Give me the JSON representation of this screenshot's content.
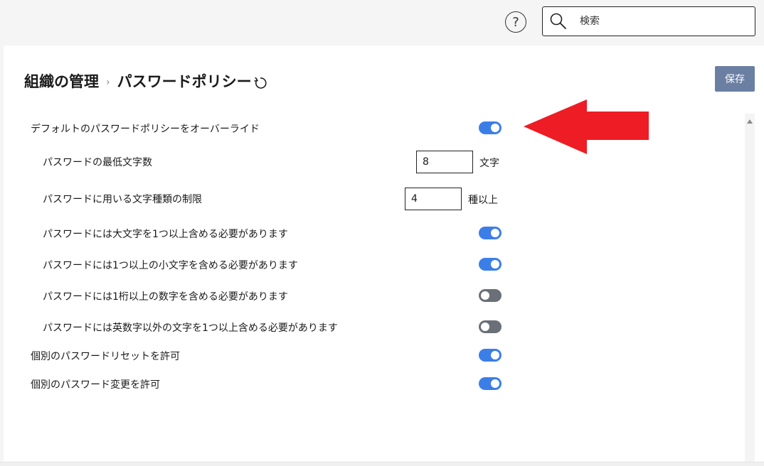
{
  "topbar": {
    "help_glyph": "?",
    "search_placeholder": "検索"
  },
  "header": {
    "breadcrumb_parent": "組織の管理",
    "breadcrumb_separator": "›",
    "page_title": "パスワードポリシー",
    "save_label": "保存"
  },
  "settings": [
    {
      "label": "デフォルトのパスワードポリシーをオーバーライド",
      "type": "toggle",
      "on": true,
      "indent": false
    },
    {
      "label": "パスワードの最低文字数",
      "type": "number",
      "value": "8",
      "unit": "文字",
      "indent": true
    },
    {
      "label": "パスワードに用いる文字種類の制限",
      "type": "number",
      "value": "4",
      "unit": "種以上",
      "indent": true
    },
    {
      "label": "パスワードには大文字を1つ以上含める必要があります",
      "type": "toggle",
      "on": true,
      "indent": true
    },
    {
      "label": "パスワードには1つ以上の小文字を含める必要があります",
      "type": "toggle",
      "on": true,
      "indent": true
    },
    {
      "label": "パスワードには1桁以上の数字を含める必要があります",
      "type": "toggle",
      "on": false,
      "indent": true
    },
    {
      "label": "パスワードには英数字以外の文字を1つ以上含める必要があります",
      "type": "toggle",
      "on": false,
      "indent": true
    },
    {
      "label": "個別のパスワードリセットを許可",
      "type": "toggle",
      "on": true,
      "indent": false
    },
    {
      "label": "個別のパスワード変更を許可",
      "type": "toggle",
      "on": true,
      "indent": false
    }
  ],
  "colors": {
    "toggle_on": "#3b7ee8",
    "toggle_off": "#6b6f77",
    "save_button": "#6b7fa3",
    "annotation_arrow": "#ee1c24"
  },
  "icons": [
    "help-icon",
    "search-icon",
    "refresh-icon",
    "red-arrow-annotation"
  ]
}
